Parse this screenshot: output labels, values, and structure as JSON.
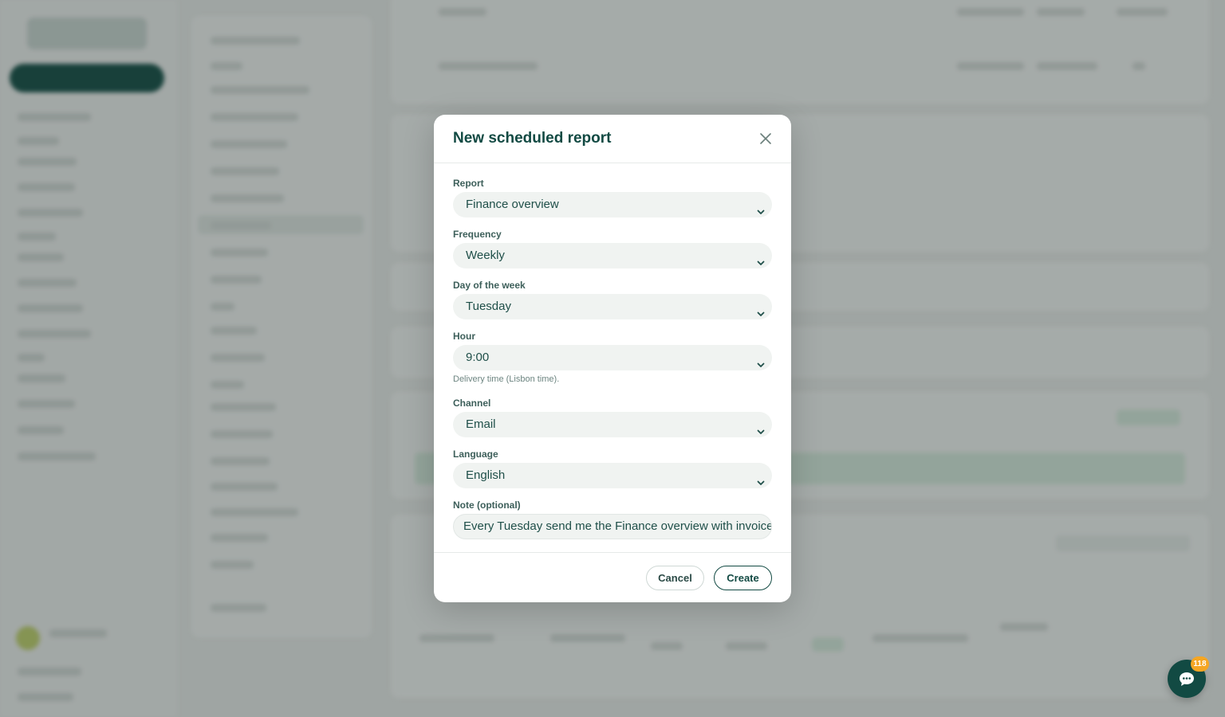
{
  "modal": {
    "title": "New scheduled report",
    "fields": {
      "report": {
        "label": "Report",
        "value": "Finance overview"
      },
      "frequency": {
        "label": "Frequency",
        "value": "Weekly"
      },
      "day": {
        "label": "Day of the week",
        "value": "Tuesday"
      },
      "hour": {
        "label": "Hour",
        "value": "9:00",
        "help": "Delivery time (Lisbon time)."
      },
      "channel": {
        "label": "Channel",
        "value": "Email"
      },
      "language": {
        "label": "Language",
        "value": "English"
      },
      "note": {
        "label": "Note (optional)",
        "value": "Every Tuesday send me the Finance overview with invoices"
      }
    },
    "buttons": {
      "cancel": "Cancel",
      "create": "Create"
    }
  },
  "chat": {
    "badge": "118",
    "icon": "chat-bubble-icon"
  },
  "colors": {
    "primary": "#124a43",
    "badge": "#f5a623",
    "field_bg": "#f0f3f1"
  }
}
